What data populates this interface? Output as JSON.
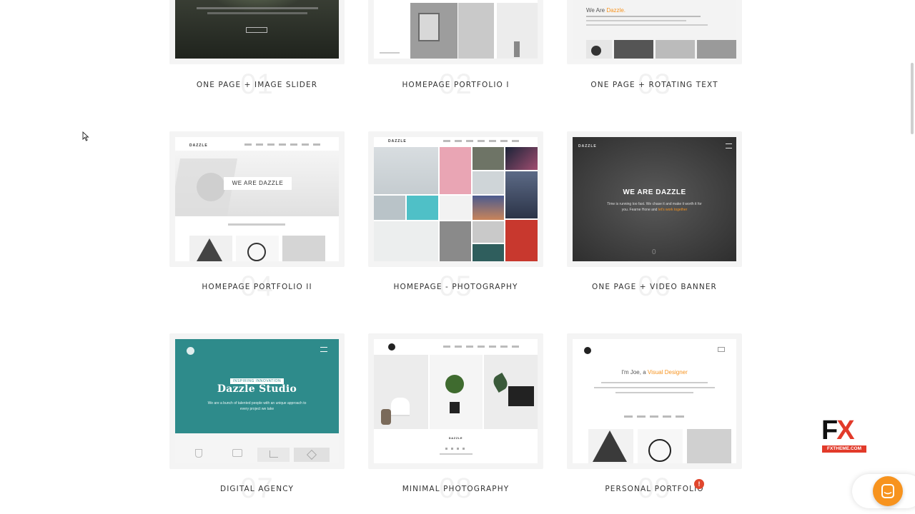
{
  "demos": [
    {
      "number": "01",
      "label": "ONE PAGE + IMAGE SLIDER"
    },
    {
      "number": "02",
      "label": "HOMEPAGE PORTFOLIO I"
    },
    {
      "number": "03",
      "label": "ONE PAGE + ROTATING TEXT"
    },
    {
      "number": "04",
      "label": "HOMEPAGE PORTFOLIO II"
    },
    {
      "number": "05",
      "label": "HOMEPAGE - PHOTOGRAPHY"
    },
    {
      "number": "06",
      "label": "ONE PAGE + VIDEO BANNER"
    },
    {
      "number": "07",
      "label": "DIGITAL AGENCY"
    },
    {
      "number": "08",
      "label": "MINIMAL PHOTOGRAPHY"
    },
    {
      "number": "09",
      "label": "PERSONAL PORTFOLIO"
    }
  ],
  "previews": {
    "p03_title": "We Are",
    "p03_title_accent": "Dazzle.",
    "p04_brand": "DAZZLE",
    "p04_hero": "WE ARE DAZZLE",
    "p05_brand": "DAZZLE",
    "p06_brand": "DAZZLE",
    "p06_hero": "WE ARE DAZZLE",
    "p06_sub": "Time is running too fast. We chase it and make it worth it for you. Fearne Hone and",
    "p06_link": "let's work together",
    "p06_num": "0",
    "p07_tag": "INSPIRING INNOVATION",
    "p07_hero": "Dazzle Studio",
    "p07_sub": "We are a bunch of talented people with an unique approach to every project we take",
    "p08_brand": "DAZZLE",
    "p09_hero": "I'm Joe, a",
    "p09_hero_accent": "Visual Designer"
  },
  "notification_count": "!",
  "watermark": {
    "big_f": "F",
    "big_x": "X",
    "small": "FXTHEME.COM"
  },
  "colors": {
    "accent_orange": "#f7931e",
    "teal": "#2e8b8b",
    "badge_red": "#e0462d",
    "fx_red": "#e23a2a"
  }
}
